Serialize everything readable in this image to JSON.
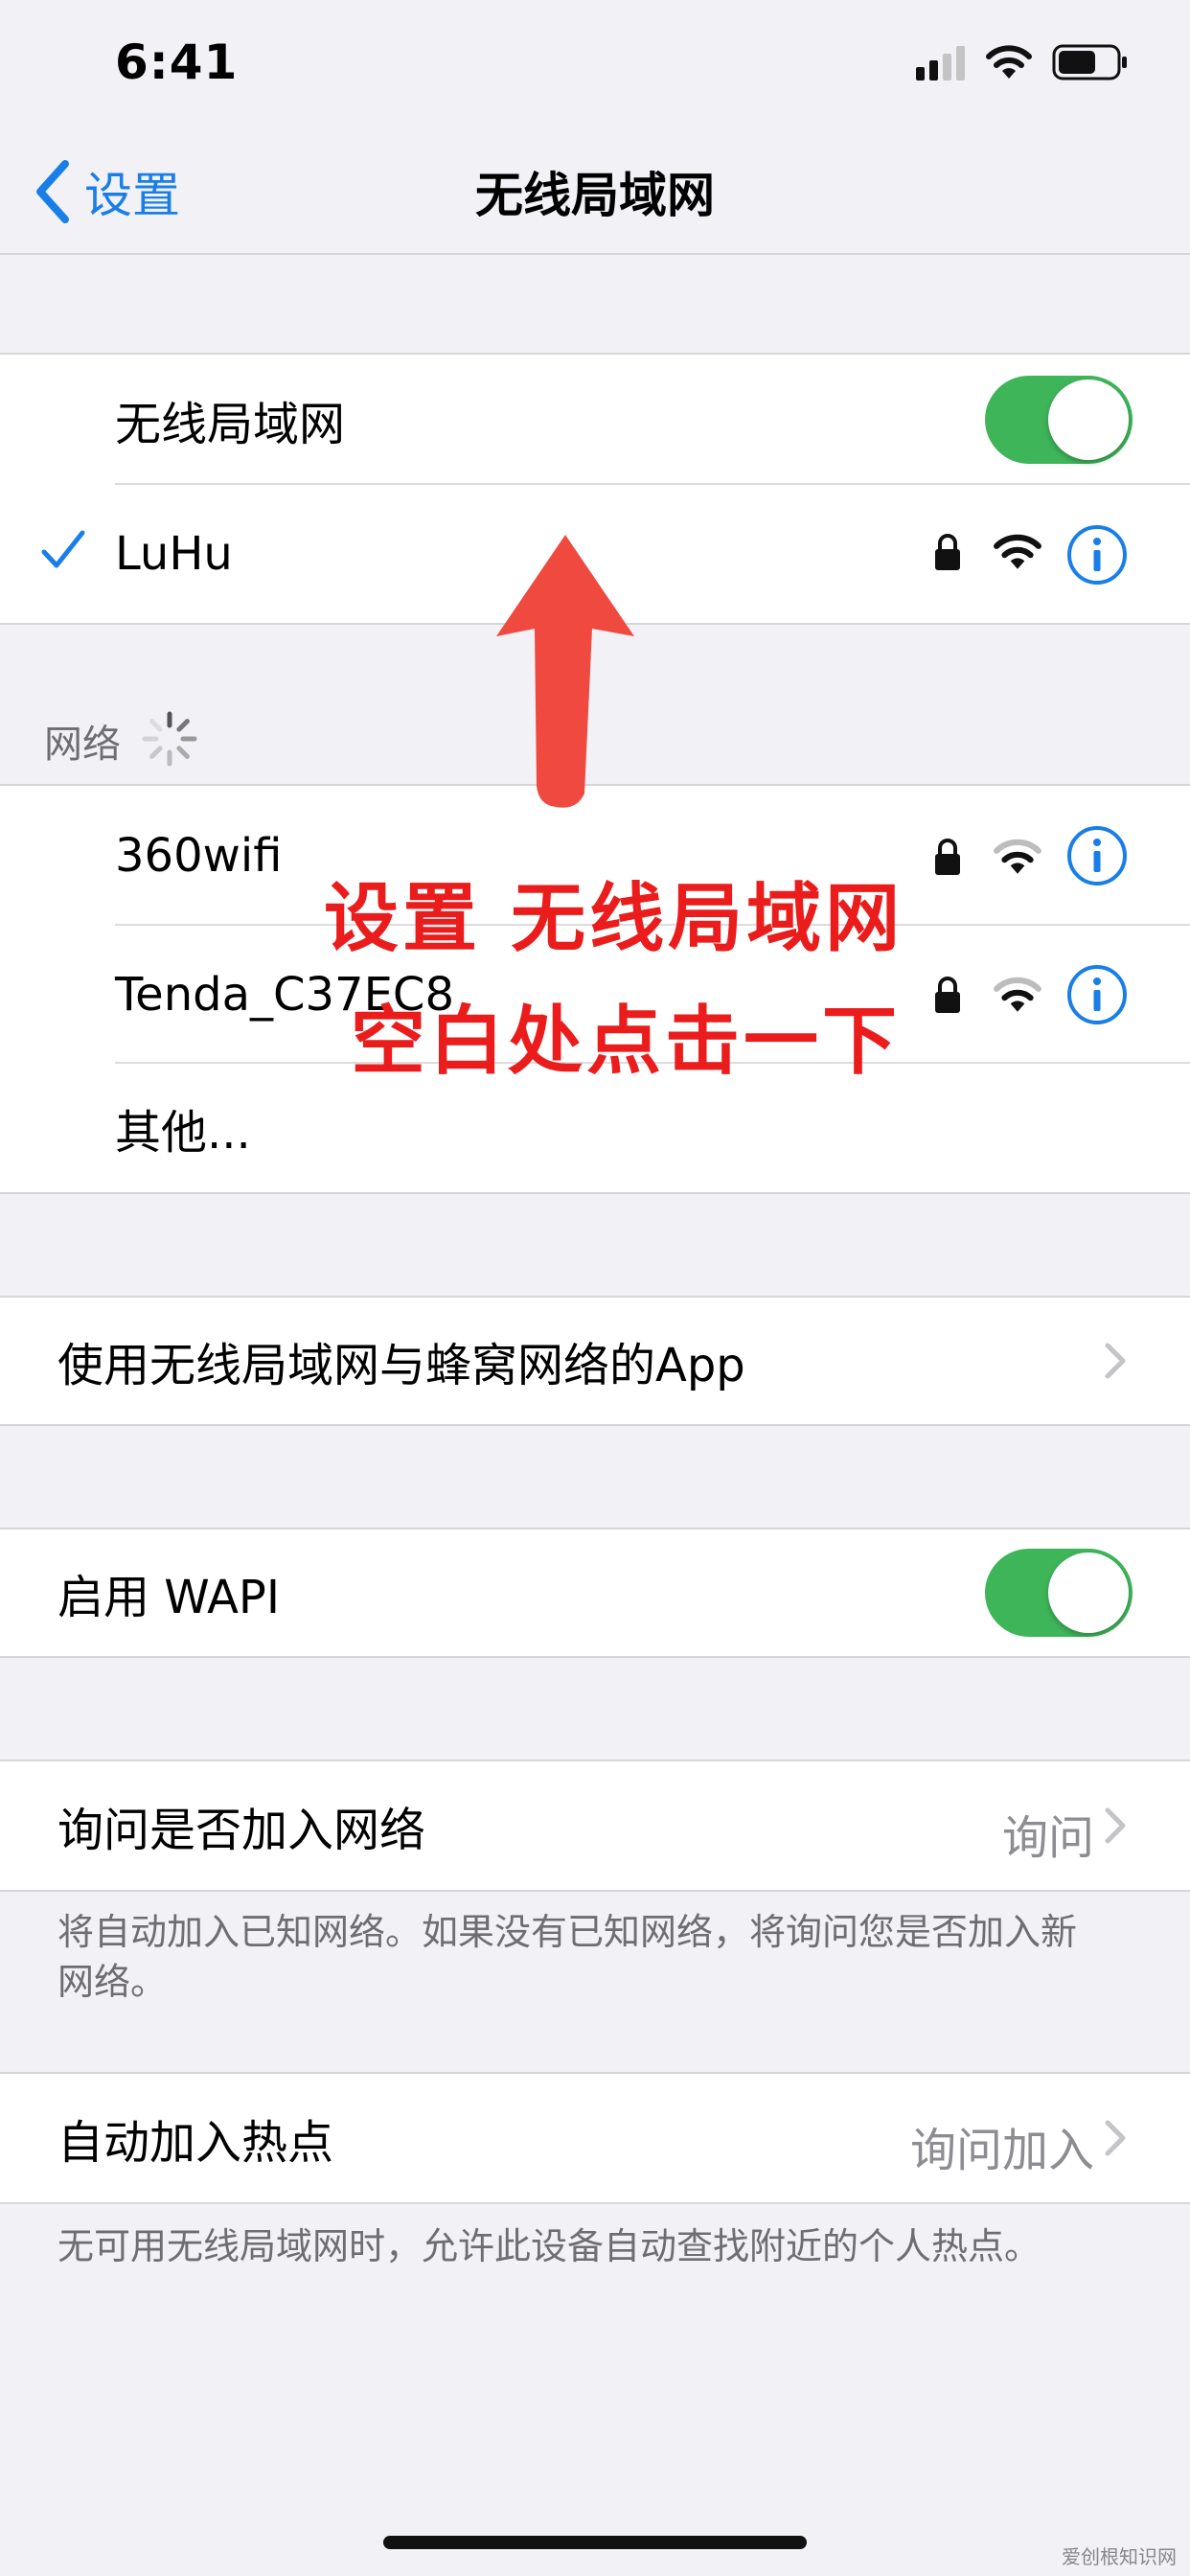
{
  "status_bar": {
    "time": "6:41"
  },
  "nav": {
    "back_label": "设置",
    "title": "无线局域网"
  },
  "wifi_group": {
    "toggle_label": "无线局域网",
    "toggle_on": true,
    "connected_network": "LuHu"
  },
  "networks": {
    "section_title": "网络",
    "items": [
      {
        "name": "360wifi"
      },
      {
        "name": "Tenda_C37EC8"
      }
    ],
    "other_label": "其他..."
  },
  "apps_row": {
    "label": "使用无线局域网与蜂窝网络的App"
  },
  "wapi": {
    "label": "启用 WAPI",
    "toggle_on": true
  },
  "ask_join": {
    "label": "询问是否加入网络",
    "value": "询问",
    "footnote": "将自动加入已知网络。如果没有已知网络，将询问您是否加入新网络。"
  },
  "hotspot": {
    "label": "自动加入热点",
    "value": "询问加入",
    "footnote": "无可用无线局域网时，允许此设备自动查找附近的个人热点。"
  },
  "annotation": {
    "line1": "设置 无线局域网",
    "line2": "空白处点击一下"
  },
  "watermark": "爱创根知识网",
  "colors": {
    "accent": "#1a7ee8",
    "toggle": "#3fb55a",
    "annotation": "#ea1c1c"
  }
}
